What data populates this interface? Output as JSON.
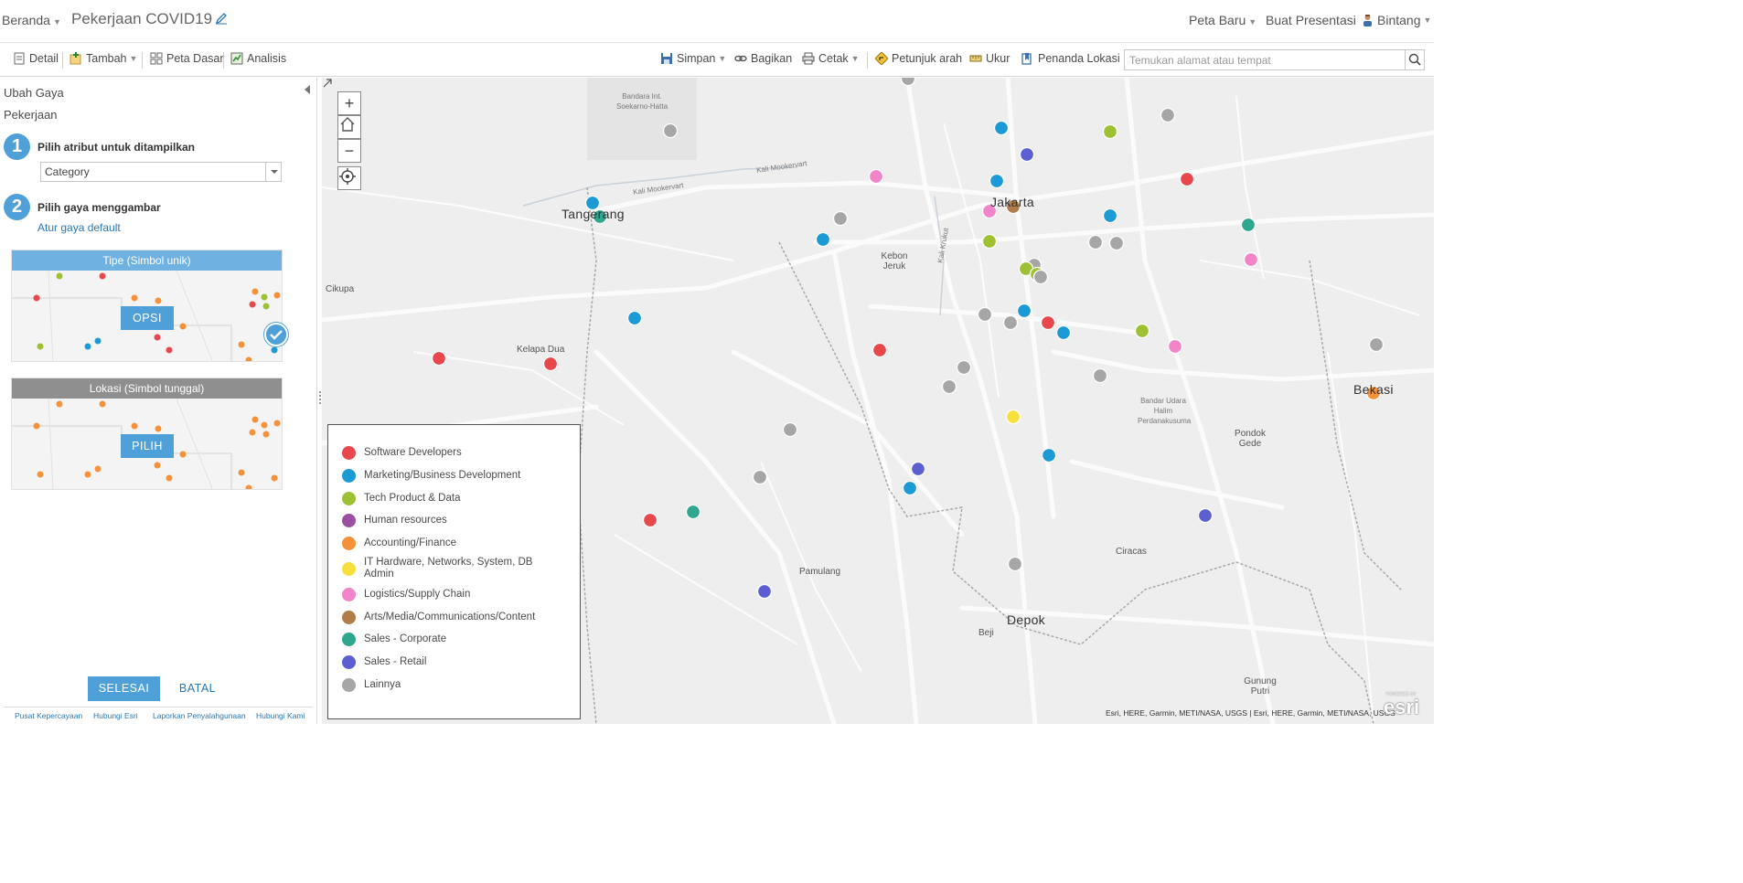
{
  "header": {
    "home": "Beranda",
    "title": "Pekerjaan COVID19",
    "new_map": "Peta Baru",
    "presentation": "Buat Presentasi",
    "user": "Bintang"
  },
  "toolbar": {
    "details": "Detail",
    "add": "Tambah",
    "basemap": "Peta Dasar",
    "analysis": "Analisis",
    "save": "Simpan",
    "share": "Bagikan",
    "print": "Cetak",
    "directions": "Petunjuk arah",
    "measure": "Ukur",
    "bookmarks": "Penanda Lokasi",
    "search_placeholder": "Temukan alamat atau tempat"
  },
  "panel": {
    "title": "Ubah Gaya",
    "layer": "Pekerjaan",
    "step1_number": "1",
    "step1_label": "Pilih atribut untuk ditampilkan",
    "attribute_value": "Category",
    "step2_number": "2",
    "step2_label": "Pilih gaya menggambar",
    "default_link": "Atur gaya default",
    "card1_title": "Tipe (Simbol unik)",
    "card1_button": "OPSI",
    "card2_title": "Lokasi (Simbol tunggal)",
    "card2_button": "PILIH",
    "done": "SELESAI",
    "cancel": "BATAL",
    "footer": [
      "Pusat Kepercayaan",
      "Hubungi Esri",
      "Laporkan Penyalahgunaan",
      "Hubungi Kami"
    ]
  },
  "map": {
    "zoom_in": "+",
    "zoom_out": "−",
    "labels": {
      "airport": "Bandara Int. Soekarno-Hatta",
      "tangerang": "Tangerang",
      "jakarta": "Jakarta",
      "kebon_jeruk": "Kebon Jeruk",
      "cikupa": "Cikupa",
      "kelapa_dua": "Kelapa Dua",
      "bekasi": "Bekasi",
      "halim": "Bandar Udara Halim Perdanakusuma",
      "pondok_gede": "Pondok Gede",
      "pamulang": "Pamulang",
      "ciracas": "Ciracas",
      "depok": "Depok",
      "beji": "Beji",
      "gunung_putri": "Gunung Putri",
      "kali_mookervart": "Kali Mookervart",
      "kali_krukut": "Kali Krukut"
    },
    "attribution": "Esri, HERE, Garmin, METI/NASA, USGS | Esri, HERE, Garmin, METI/NASA, USGS",
    "esri_powered": "POWERED BY",
    "esri_logo": "esri"
  },
  "legend": [
    {
      "label": "Software Developers",
      "color": "#e8474c"
    },
    {
      "label": "Marketing/Business Development",
      "color": "#1c9ad6"
    },
    {
      "label": "Tech Product & Data",
      "color": "#9dc132"
    },
    {
      "label": "Human resources",
      "color": "#9a4fa0"
    },
    {
      "label": "Accounting/Finance",
      "color": "#f6913a"
    },
    {
      "label": "IT Hardware, Networks, System, DB Admin",
      "color": "#f8e03c"
    },
    {
      "label": "Logistics/Supply Chain",
      "color": "#f285c9"
    },
    {
      "label": "Arts/Media/Communications/Content",
      "color": "#b07d49"
    },
    {
      "label": "Sales - Corporate",
      "color": "#2fa68e"
    },
    {
      "label": "Sales - Retail",
      "color": "#5b5fd2"
    },
    {
      "label": "Lainnya",
      "color": "#a6a6a6"
    }
  ]
}
